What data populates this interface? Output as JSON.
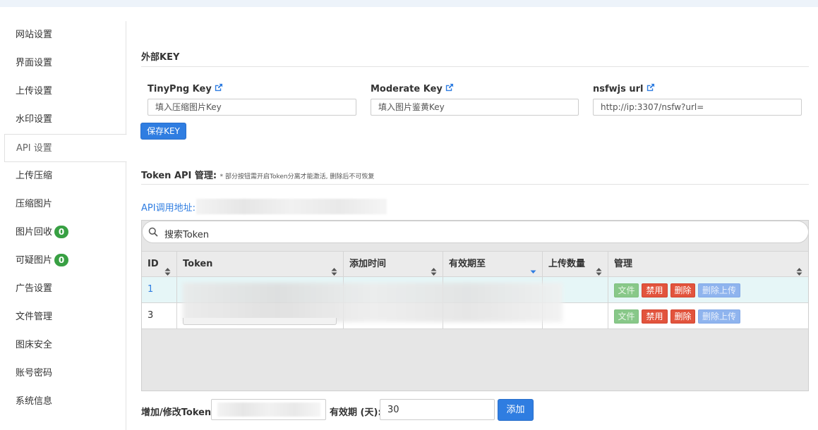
{
  "sidebar": {
    "items": [
      {
        "label": "网站设置"
      },
      {
        "label": "界面设置"
      },
      {
        "label": "上传设置"
      },
      {
        "label": "水印设置"
      },
      {
        "label": "API 设置",
        "active": true
      },
      {
        "label": "上传压缩"
      },
      {
        "label": "压缩图片"
      },
      {
        "label": "图片回收",
        "badge": "0"
      },
      {
        "label": "可疑图片",
        "badge": "0"
      },
      {
        "label": "广告设置"
      },
      {
        "label": "文件管理"
      },
      {
        "label": "图床安全"
      },
      {
        "label": "账号密码"
      },
      {
        "label": "系统信息"
      }
    ]
  },
  "external_key": {
    "title": "外部KEY",
    "fields": [
      {
        "label": "TinyPng Key",
        "placeholder": "填入压缩图片Key",
        "value": ""
      },
      {
        "label": "Moderate Key",
        "placeholder": "填入图片鉴黄Key",
        "value": ""
      },
      {
        "label": "nsfwjs url",
        "placeholder": "",
        "value": "http://ip:3307/nsfw?url="
      }
    ],
    "save_label": "保存KEY"
  },
  "token_api": {
    "title": "Token API 管理:",
    "note": "* 部分按钮需开启Token分离才能激活, 删除后不可恢复",
    "url_label": "API调用地址:",
    "search_placeholder": "搜索Token",
    "columns": [
      "ID",
      "Token",
      "添加时间",
      "有效期至",
      "上传数量",
      "管理"
    ],
    "rows": [
      {
        "id": "1",
        "highlight": true
      },
      {
        "id": "3",
        "highlight": false
      }
    ],
    "actions": {
      "file": "文件",
      "disable": "禁用",
      "delete": "删除",
      "delete_uploads": "删除上传"
    }
  },
  "add_token": {
    "label": "增加/修改Token:",
    "validity_label": "有效期 (天):",
    "validity_value": "30",
    "add_label": "添加"
  },
  "colors": {
    "primary": "#2f7de1",
    "badge_green": "#38a043",
    "danger": "#e2543d",
    "row_highlight": "#e6f6f7"
  }
}
